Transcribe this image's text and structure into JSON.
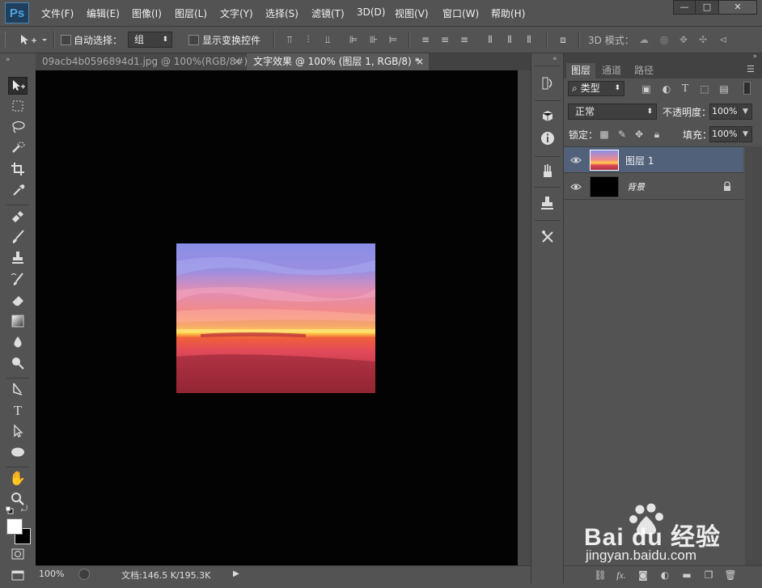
{
  "app": {
    "logo": "Ps"
  },
  "menu": [
    "文件(F)",
    "编辑(E)",
    "图像(I)",
    "图层(L)",
    "文字(Y)",
    "选择(S)",
    "滤镜(T)",
    "3D(D)",
    "视图(V)",
    "窗口(W)",
    "帮助(H)"
  ],
  "window_controls": {
    "minimize": "—",
    "maximize": "□",
    "close": "✕"
  },
  "options": {
    "auto_select_label": "自动选择：",
    "auto_select_value": "组",
    "show_transform_label": "显示变换控件",
    "mode_3d_label": "3D 模式："
  },
  "tabs": [
    {
      "label": "09acb4b0596894d1.jpg @ 100%(RGB/8#)",
      "close": "×"
    },
    {
      "label": "文字效果 @ 100% (图层 1, RGB/8) *",
      "close": "×"
    }
  ],
  "status": {
    "zoom": "100%",
    "doc_info": "文档:146.5 K/195.3K"
  },
  "panel": {
    "tabs": [
      "图层",
      "通道",
      "路径"
    ],
    "filter_type": "类型",
    "blend_mode": "正常",
    "opacity_label": "不透明度：",
    "opacity_value": "100%",
    "lock_label": "锁定：",
    "fill_label": "填充：",
    "fill_value": "100%",
    "layers": [
      {
        "name": "图层 1",
        "selected": true
      },
      {
        "name": "背景",
        "locked": true
      }
    ]
  },
  "watermark": {
    "brand": "Bai du 经验",
    "url": "jingyan.baidu.com"
  },
  "colors": {
    "ui_bg": "#535353",
    "canvas_bg": "#030303",
    "selected_layer": "#51617a",
    "accent": "#4fa3e0"
  }
}
